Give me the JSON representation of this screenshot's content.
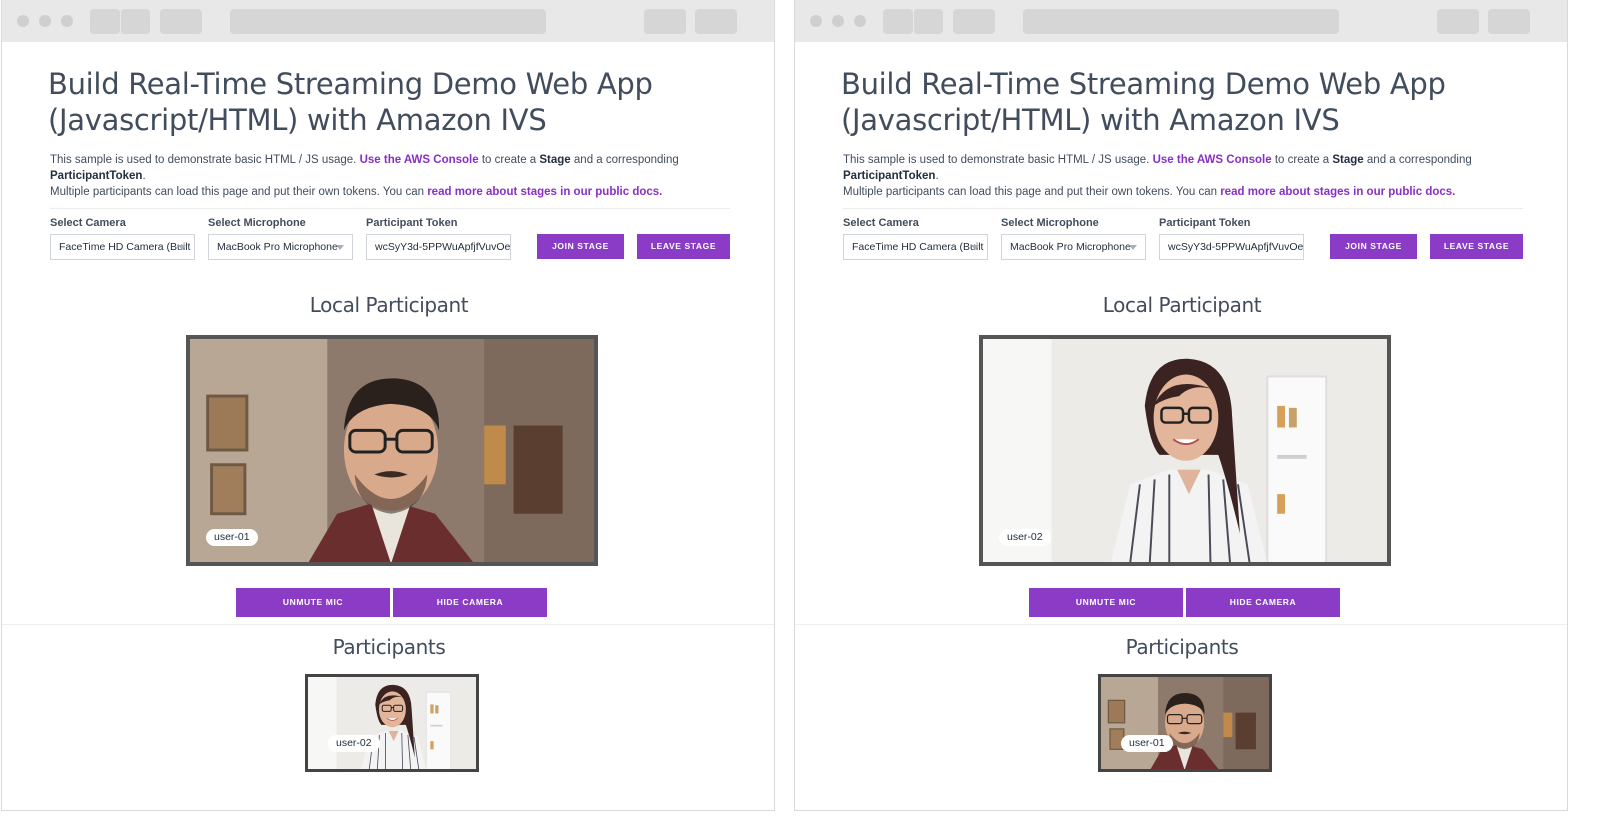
{
  "title_line1": "Build Real-Time Streaming Demo Web App",
  "title_line2": "(Javascript/HTML) with Amazon IVS",
  "desc": {
    "t1": "This sample is used to demonstrate basic HTML / JS usage. ",
    "link1": "Use the AWS Console",
    "t2": " to create a ",
    "stage": "Stage",
    "t3": " and a corresponding ",
    "token": "ParticipantToken",
    "t4": ".",
    "t5": "Multiple participants can load this page and put their own tokens. You can ",
    "link2": "read more about stages in our public docs."
  },
  "form": {
    "camera_label": "Select Camera",
    "camera_value": "FaceTime HD Camera (Built",
    "mic_label": "Select Microphone",
    "mic_value": "MacBook Pro Microphone",
    "token_label": "Participant Token",
    "token_value": "wcSyY3d-5PPWuApfjfVuvOe",
    "join_label": "JOIN STAGE",
    "leave_label": "LEAVE STAGE"
  },
  "local_title": "Local Participant",
  "participants_title": "Participants",
  "unmute_label": "UNMUTE MIC",
  "hide_camera_label": "HIDE CAMERA",
  "left": {
    "local_user": "user-01",
    "remote_user": "user-02"
  },
  "right": {
    "local_user": "user-02",
    "remote_user": "user-01"
  },
  "colors": {
    "accent": "#8a3cc6",
    "link": "#8a2fc4",
    "heading": "#414d5c"
  }
}
